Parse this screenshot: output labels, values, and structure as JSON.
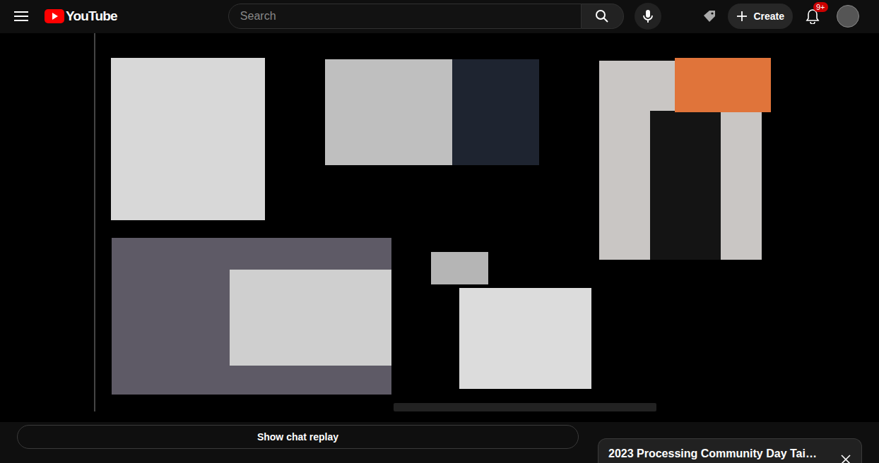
{
  "header": {
    "logo": "YouTube",
    "search": {
      "placeholder": "Search"
    },
    "create": "Create",
    "notifications_badge": "9+"
  },
  "chat": {
    "button": "Show chat replay"
  },
  "playlist_panel": {
    "title": "2023 Processing Community Day Tai…"
  }
}
